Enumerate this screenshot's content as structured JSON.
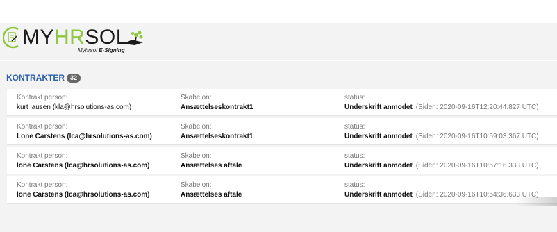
{
  "brand": {
    "name_part1": "MY",
    "name_part2": "HR",
    "name_part3": "SOL",
    "subtitle_prefix": "Myhrsol",
    "subtitle_suffix": "E-Signing",
    "colors": {
      "accent": "#8dc63f",
      "dark": "#1a1a1a",
      "title_blue": "#2b5fa8"
    }
  },
  "section": {
    "title": "KONTRAKTER",
    "count": "32"
  },
  "labels": {
    "person": "Kontrakt person:",
    "template": "Skabelon:",
    "status": "status:"
  },
  "contracts": [
    {
      "person": "kurt lausen (kla@hrsolutions-as.com)",
      "template": "Ansættelseskontrakt1",
      "status": "Underskrift anmodet",
      "since": "(Siden: 2020-09-16T12:20:44.827 UTC)"
    },
    {
      "person": "Lone Carstens (lca@hrsolutions-as.com)",
      "template": "Ansættelseskontrakt1",
      "status": "Underskrift anmodet",
      "since": "(Siden: 2020-09-16T10:59:03.367 UTC)"
    },
    {
      "person": "lone Carstens (lca@hrsolutions-as.com)",
      "template": "Ansættelses aftale",
      "status": "Underskrift anmodet",
      "since": "(Siden: 2020-09-16T10:57:16.333 UTC)"
    },
    {
      "person": "lone Carstens (lca@hrsolutions-as.com)",
      "template": "Ansættelses aftale",
      "status": "Underskrift anmodet",
      "since": "(Siden: 2020-09-16T10:54:36.633 UTC)"
    }
  ],
  "icons": {
    "logo_mark": "document-pen-icon",
    "logo_plant": "plant-icon"
  }
}
